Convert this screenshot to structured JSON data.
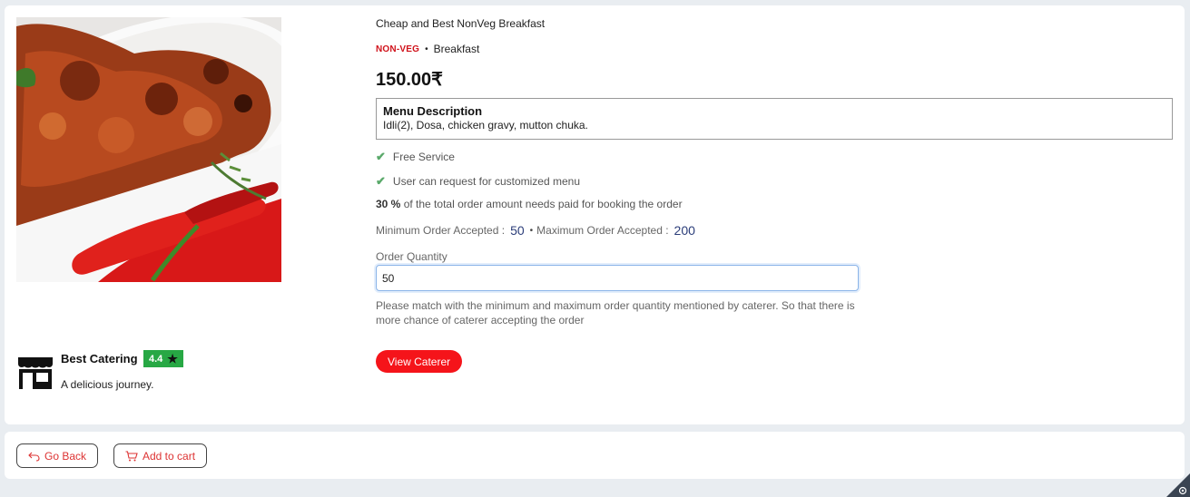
{
  "menu": {
    "title": "Cheap and Best NonVeg Breakfast",
    "type_tag": "NON-VEG",
    "category": "Breakfast",
    "price": "150.00₹"
  },
  "description": {
    "heading": "Menu Description",
    "text": "Idli(2), Dosa, chicken gravy, mutton chuka."
  },
  "features": [
    {
      "icon": "check-icon",
      "label": "Free Service"
    },
    {
      "icon": "check-icon",
      "label": "User can request for customized menu"
    }
  ],
  "advance": {
    "percent": "30 %",
    "text": "of the total order amount needs paid for booking the order"
  },
  "limits": {
    "min_label": "Minimum Order Accepted :",
    "min_value": "50",
    "max_label": "Maximum Order Accepted :",
    "max_value": "200"
  },
  "order": {
    "label": "Order Quantity",
    "value": "50",
    "help": "Please match with the minimum and maximum order quantity mentioned by caterer. So that there is more chance of caterer accepting the order"
  },
  "caterer": {
    "name": "Best Catering",
    "rating": "4.4",
    "tagline": "A delicious journey.",
    "view_button": "View Caterer"
  },
  "footer": {
    "back_label": "Go Back",
    "cart_label": "Add to cart"
  },
  "colors": {
    "accent_red": "#f5141a",
    "rating_green": "#27a844",
    "check_green": "#5aa96a"
  }
}
